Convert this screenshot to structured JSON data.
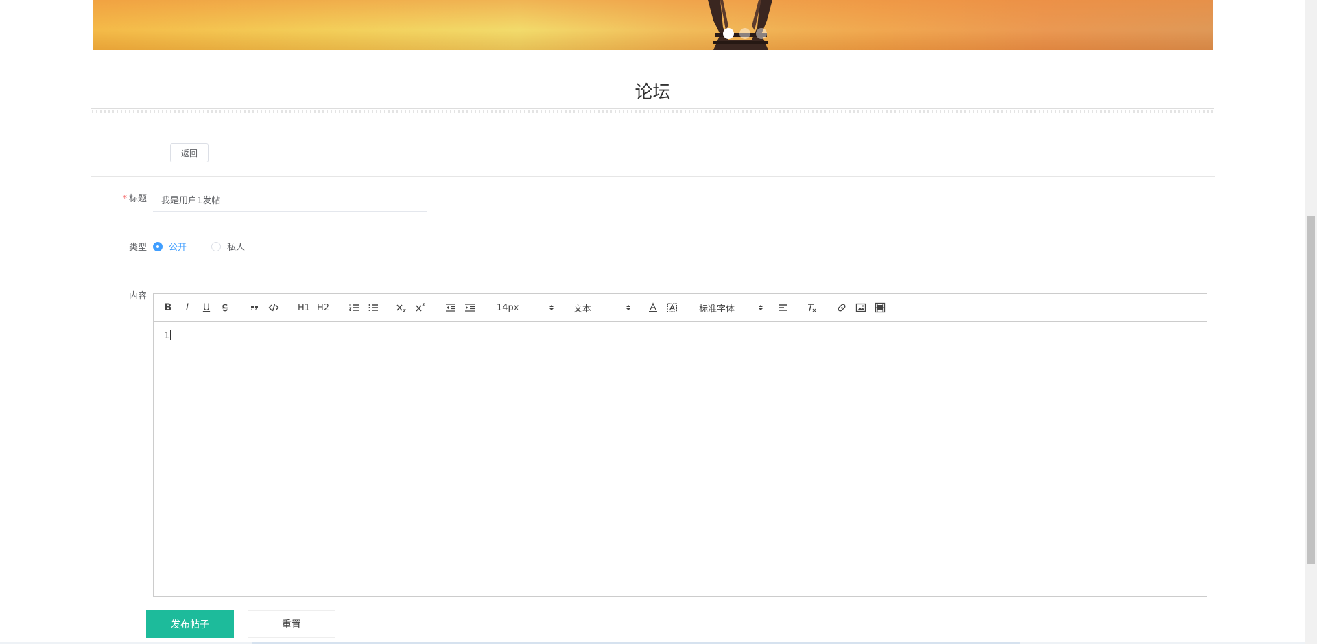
{
  "banner": {
    "slides": [
      "",
      "",
      ""
    ],
    "active_slide": 1
  },
  "page": {
    "title": "论坛"
  },
  "back_button": {
    "label": "返回"
  },
  "form": {
    "title_field": {
      "label": "标题",
      "value": "我是用户1发帖",
      "required": true
    },
    "type_field": {
      "label": "类型",
      "options": [
        {
          "label": "公开",
          "checked": true
        },
        {
          "label": "私人",
          "checked": false
        }
      ]
    },
    "content_field": {
      "label": "内容",
      "text": "1"
    }
  },
  "editor_toolbar": {
    "bold": "B",
    "italic": "I",
    "underline": "U",
    "h1": "H1",
    "h2": "H2",
    "font_size": "14px",
    "header_select": "文本",
    "font_family": "标准字体"
  },
  "actions": {
    "submit_label": "发布帖子",
    "reset_label": "重置"
  },
  "colors": {
    "primary": "#1dbb9b",
    "radio_active": "#409eff",
    "required": "#f56c6c"
  }
}
